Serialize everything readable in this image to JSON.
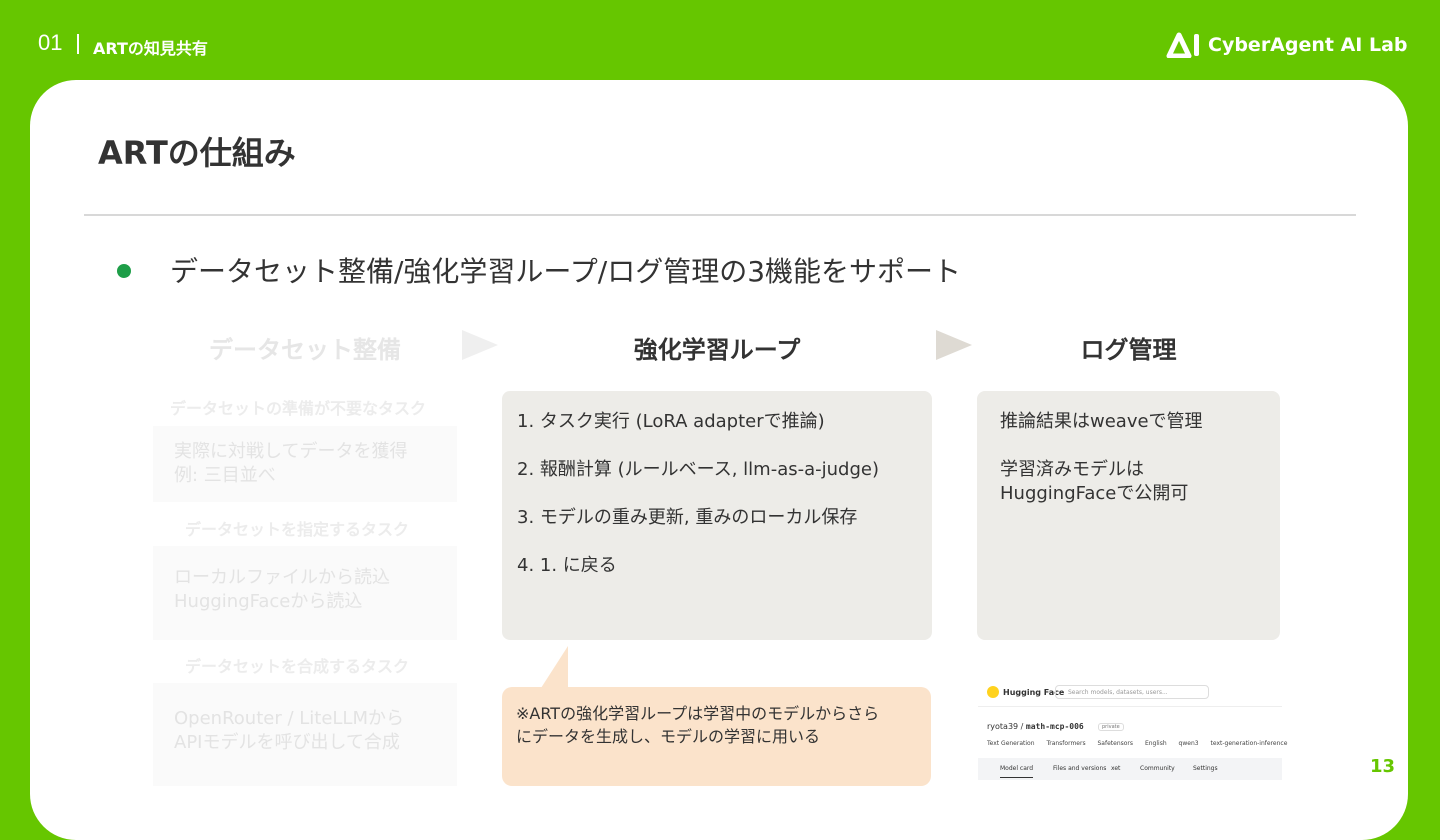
{
  "header": {
    "section_number": "01",
    "section_title": "ARTの知見共有",
    "logo_text": "CyberAgent AI Lab",
    "page_number": "13"
  },
  "slide": {
    "title": "ARTの仕組み",
    "bullet": "データセット整備/強化学習ループ/ログ管理の3機能をサポート"
  },
  "columns": {
    "dataset": {
      "heading": "データセット整備",
      "groups": [
        {
          "label": "データセットの準備が不要なタスク",
          "lines": [
            "実際に対戦してデータを獲得",
            "例: 三目並べ"
          ]
        },
        {
          "label": "データセットを指定するタスク",
          "lines": [
            "ローカルファイルから読込",
            "HuggingFaceから読込"
          ]
        },
        {
          "label": "データセットを合成するタスク",
          "lines": [
            "OpenRouter / LiteLLMから",
            "APIモデルを呼び出して合成"
          ]
        }
      ]
    },
    "rl_loop": {
      "heading": "強化学習ループ",
      "steps": [
        "1. タスク実行 (LoRA adapterで推論)",
        "2. 報酬計算 (ルールベース, llm-as-a-judge)",
        "3. モデルの重み更新, 重みのローカル保存",
        "4. 1. に戻る"
      ],
      "note_lines": [
        "※ARTの強化学習ループは学習中のモデルからさら",
        "にデータを生成し、モデルの学習に用いる"
      ]
    },
    "log": {
      "heading": "ログ管理",
      "lines": [
        "推論結果はweaveで管理",
        "",
        "学習済みモデルは",
        "HuggingFaceで公開可"
      ]
    }
  },
  "hf_screenshot": {
    "brand": "Hugging Face",
    "search_placeholder": "Search models, datasets, users...",
    "user": "ryota39",
    "repo": "math-mcp-006",
    "private_label": "private",
    "tags": [
      "Text Generation",
      "Transformers",
      "Safetensors",
      "English",
      "qwen3",
      "text-generation-inference"
    ],
    "tabs": [
      "Model card",
      "Files and versions",
      "xet",
      "Community",
      "Settings"
    ]
  },
  "colors": {
    "brand_green": "#66c600",
    "bullet_green": "#1e9e48",
    "box_gray": "#edece8",
    "note_peach": "#fbe3cb"
  }
}
